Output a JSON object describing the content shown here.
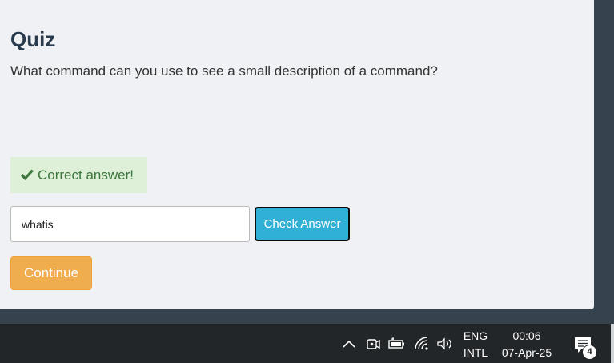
{
  "quiz": {
    "title": "Quiz",
    "question": "What command can you use to see a small description of a command?",
    "feedback": "Correct answer!",
    "answer_value": "whatis",
    "check_label": "Check Answer",
    "continue_label": "Continue"
  },
  "colors": {
    "check_button": "#31b0d5",
    "continue_button": "#f0ad4e",
    "success_bg": "#dff0d8",
    "success_text": "#3c763d"
  },
  "taskbar": {
    "icons": [
      "chevron-up-icon",
      "meet-now-icon",
      "battery-icon",
      "wifi-icon",
      "volume-icon"
    ],
    "language": {
      "line1": "ENG",
      "line2": "INTL"
    },
    "clock": {
      "time": "00:06",
      "date": "07-Apr-25"
    },
    "notification_count": "4"
  }
}
